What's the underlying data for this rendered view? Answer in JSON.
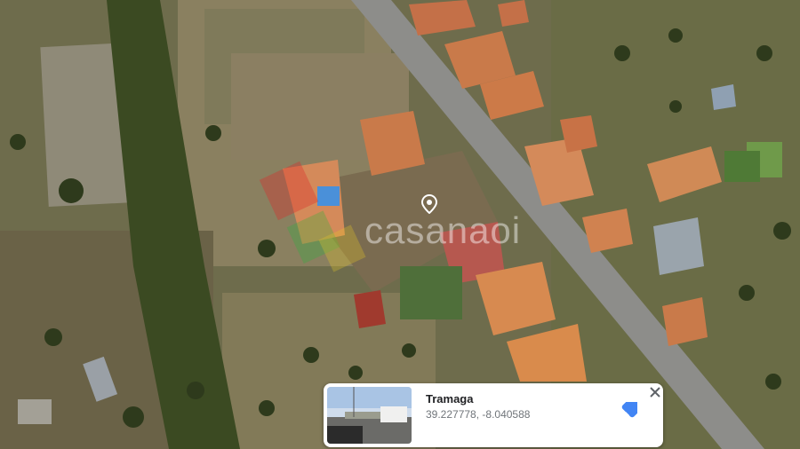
{
  "watermark": {
    "text": "casanaoi"
  },
  "icons": {
    "pin": "location-pin-icon",
    "directions": "directions-arrow-icon",
    "close": "close-icon"
  },
  "colors": {
    "accent": "#4285f4",
    "pin": "#ffffff"
  },
  "place_card": {
    "name": "Tramaga",
    "coordinates": "39.227778, -8.040588"
  }
}
